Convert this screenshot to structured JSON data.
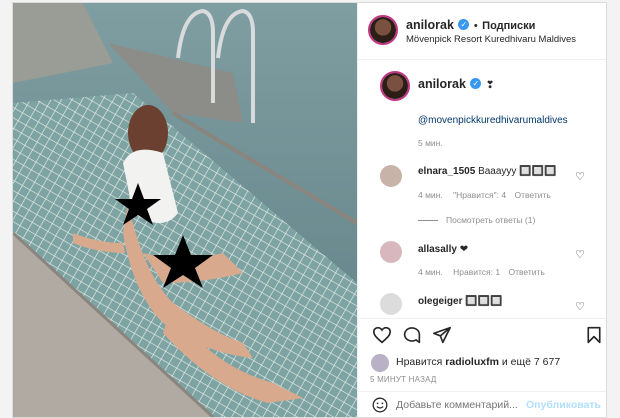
{
  "post": {
    "author": "anilorak",
    "verified_mark": "✓",
    "separator": "•",
    "follow_state": "Подписки",
    "location": "Mövenpick Resort Kuredhivaru Maldives",
    "caption_icon": "❣",
    "caption_mention": "@movenpickkuredhivarumaldives",
    "caption_time": "5 мин."
  },
  "comments": [
    {
      "user": "elnara_1505",
      "text": "Вaaayyy 🔲🔲🔲",
      "time": "4 мин.",
      "likes": "\"Нравится\": 4",
      "reply": "Ответить",
      "view_replies": "Посмотреть ответы (1)"
    },
    {
      "user": "allasally",
      "text": "❤",
      "time": "4 мин.",
      "likes": "Нравится: 1",
      "reply": "Ответить"
    },
    {
      "user": "olegeiger",
      "text": "🔲🔲🔲"
    }
  ],
  "likes": {
    "prefix": "Нравится",
    "user": "radioluxfm",
    "and_more": "и ещё 7 677"
  },
  "post_time": "5 МИНУТ НАЗАД",
  "comment_box": {
    "placeholder": "Добавьте комментарий...",
    "publish": "Опубликовать"
  },
  "icons": {
    "like": "heart-icon",
    "comment": "comment-icon",
    "share": "share-icon",
    "save": "bookmark-icon",
    "emoji": "emoji-icon"
  },
  "colors": {
    "verified": "#3897f0",
    "link": "#00376b",
    "publish_disabled": "#b2dffc",
    "muted": "#8e8e8e"
  }
}
